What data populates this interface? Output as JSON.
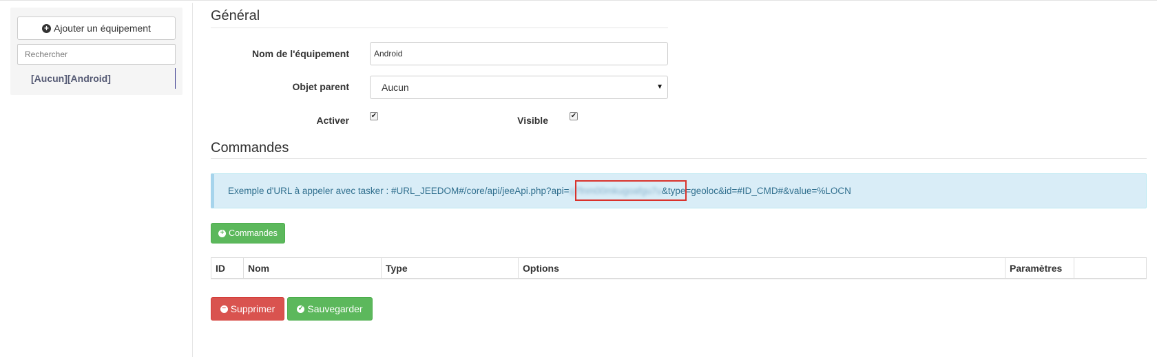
{
  "sidebar": {
    "add_button_label": "Ajouter un équipement",
    "search_placeholder": "Rechercher",
    "equipment_item": "[Aucun][Android]"
  },
  "general": {
    "title": "Général",
    "name_label": "Nom de l'équipement",
    "name_value": "Android",
    "parent_label": "Objet parent",
    "parent_value": "Aucun",
    "activate_label": "Activer",
    "activate_checked": true,
    "visible_label": "Visible",
    "visible_checked": true
  },
  "commands": {
    "title": "Commandes",
    "url_prefix": "Exemple d'URL à appeler avec tasker : #URL_JEEDOM#/core/api/jeeApi.php?api=",
    "url_api_key": "q7fnm00mkugoafgu7u",
    "url_suffix": "&type=geoloc&id=#ID_CMD#&value=%LOCN",
    "add_button_label": "Commandes",
    "table_headers": [
      "ID",
      "Nom",
      "Type",
      "Options",
      "Paramètres",
      ""
    ]
  },
  "actions": {
    "delete_label": "Supprimer",
    "save_label": "Sauvegarder"
  },
  "colors": {
    "success": "#5cb85c",
    "danger": "#d9534f",
    "info_bg": "#d9edf7",
    "highlight": "#d9322b"
  }
}
